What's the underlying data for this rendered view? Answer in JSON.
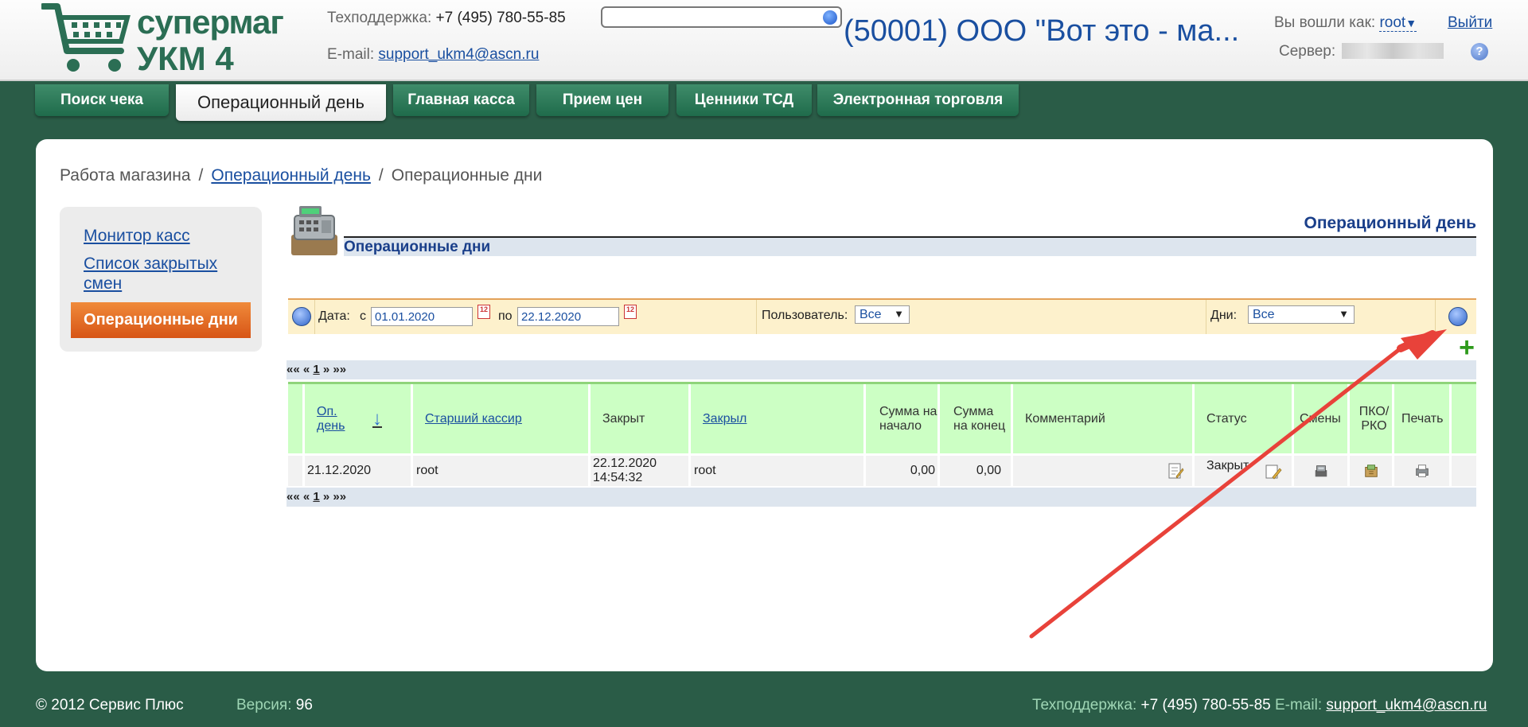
{
  "header": {
    "logo_line1": "супермаг",
    "logo_line2": "УКМ 4",
    "support_label": "Техподдержка:",
    "support_phone": "+7 (495) 780-55-85",
    "email_label": "E-mail:",
    "email": "support_ukm4@ascn.ru",
    "search_placeholder": "",
    "store_title": "(50001) ООО \"Вот это - ма...",
    "logged_as_label": "Вы вошли как:",
    "user": "root",
    "logout": "Выйти",
    "server_label": "Сервер:",
    "help_glyph": "?"
  },
  "tabs": [
    {
      "label": "Поиск чека"
    },
    {
      "label": "Операционный день",
      "active": true
    },
    {
      "label": "Главная касса"
    },
    {
      "label": "Прием цен"
    },
    {
      "label": "Ценники ТСД"
    },
    {
      "label": "Электронная торговля"
    }
  ],
  "breadcrumb": {
    "item1": "Работа магазина",
    "sep": "/",
    "item2": "Операционный день",
    "item3": "Операционные дни"
  },
  "sidenav": {
    "items": [
      {
        "label": "Монитор касс"
      },
      {
        "label": "Список закрытых смен"
      },
      {
        "label": "Операционные дни",
        "active": true
      }
    ]
  },
  "section": {
    "title_right": "Операционный день",
    "title_left": "Операционные дни"
  },
  "filter": {
    "date_label": "Дата:",
    "from_label": "с",
    "date_from": "01.01.2020",
    "to_label": "по",
    "date_to": "22.12.2020",
    "user_label": "Пользователь:",
    "user_value": "Все",
    "days_label": "Дни:",
    "days_value": "Все",
    "cal_glyph": "12"
  },
  "pager": {
    "first": "««",
    "prev": "«",
    "page": "1",
    "next": "»",
    "last": "»»"
  },
  "table": {
    "columns": [
      "Оп. день",
      "Старший кассир",
      "Закрыт",
      "Закрыл",
      "Сумма на начало",
      "Сумма на конец",
      "Комментарий",
      "Статус",
      "Смены",
      "ПКО/ РКО",
      "Печать"
    ],
    "rows": [
      {
        "day": "21.12.2020",
        "cashier": "root",
        "closed": "22.12.2020 14:54:32",
        "closed_by": "root",
        "sum_start": "0,00",
        "sum_end": "0,00",
        "comment": "",
        "status": "Закрыт"
      }
    ]
  },
  "footer": {
    "copyright": "© 2012 Сервис Плюс",
    "version_label": "Версия:",
    "version": "96",
    "support_label": "Техподдержка:",
    "support_phone": "+7 (495) 780-55-85",
    "email_label": "E-mail:",
    "email": "support_ukm4@ascn.ru"
  },
  "colors": {
    "page_bg": "#2a5c47",
    "tab_green": "#2e7a58",
    "link_blue": "#1a4fa0",
    "active_orange": "#e06a22",
    "table_header": "#ccffc4",
    "filter_bg": "#fdf1cc",
    "arrow_red": "#e8423a"
  }
}
